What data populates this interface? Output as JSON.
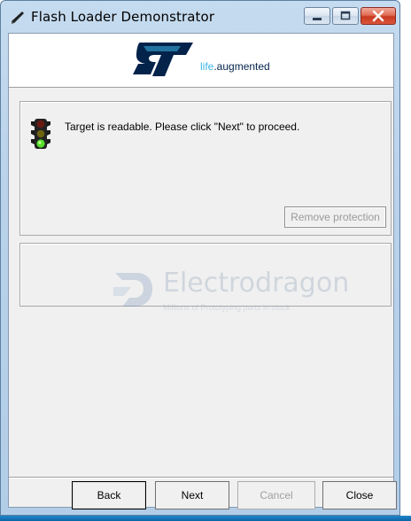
{
  "window": {
    "title": "Flash Loader Demonstrator"
  },
  "banner": {
    "logo": "ST",
    "tagline_life": "life",
    "tagline_rest": ".augmented"
  },
  "status": {
    "message": "Target is readable. Please click \"Next\" to proceed.",
    "icon": "traffic-light-icon"
  },
  "buttons": {
    "remove_protection": "Remove protection",
    "back": "Back",
    "next": "Next",
    "cancel": "Cancel",
    "close": "Close"
  },
  "watermark": {
    "title": "Electrodragon",
    "subtitle": "Millions of Prototyping parts in stock"
  },
  "colors": {
    "st_blue": "#03234b",
    "st_cyan": "#3cb4e6",
    "titlebar": "#c5dbef"
  }
}
